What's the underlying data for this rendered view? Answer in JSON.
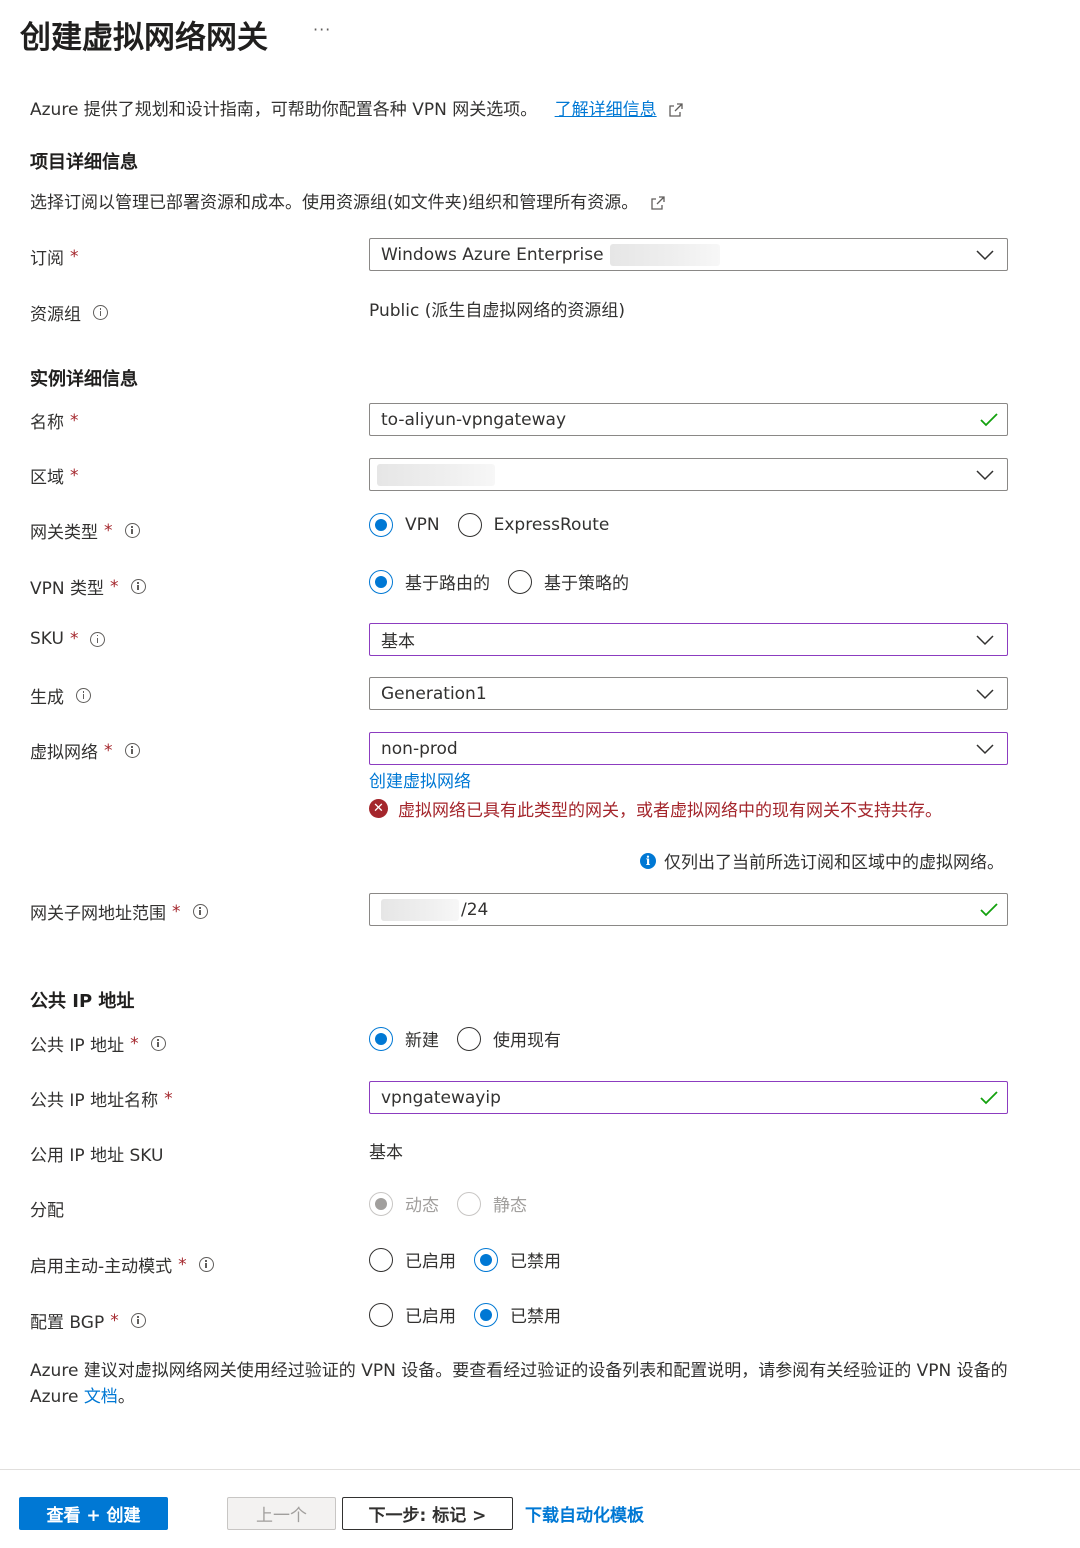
{
  "header": {
    "title": "创建虚拟网络网关",
    "more": "···"
  },
  "intro": {
    "text": "Azure 提供了规划和设计指南，可帮助你配置各种 VPN 网关选项。",
    "link": "了解详细信息"
  },
  "project": {
    "heading": "项目详细信息",
    "description": "选择订阅以管理已部署资源和成本。使用资源组(如文件夹)组织和管理所有资源。",
    "subscription": {
      "label": "订阅",
      "required": "*",
      "value": "Windows Azure Enterprise"
    },
    "resource_group": {
      "label": "资源组",
      "value": "Public (派生自虚拟网络的资源组)"
    }
  },
  "instance": {
    "heading": "实例详细信息",
    "name": {
      "label": "名称",
      "required": "*",
      "value": "to-aliyun-vpngateway"
    },
    "region": {
      "label": "区域",
      "required": "*"
    },
    "gateway_type": {
      "label": "网关类型",
      "required": "*",
      "options": [
        "VPN",
        "ExpressRoute"
      ],
      "selected": "VPN"
    },
    "vpn_type": {
      "label": "VPN 类型",
      "required": "*",
      "options": [
        "基于路由的",
        "基于策略的"
      ],
      "selected": "基于路由的"
    },
    "sku": {
      "label": "SKU",
      "required": "*",
      "value": "基本"
    },
    "generation": {
      "label": "生成",
      "value": "Generation1"
    },
    "vnet": {
      "label": "虚拟网络",
      "required": "*",
      "value": "non-prod",
      "create_link": "创建虚拟网络",
      "error": "虚拟网络已具有此类型的网关，或者虚拟网络中的现有网关不支持共存。",
      "note": "仅列出了当前所选订阅和区域中的虚拟网络。"
    },
    "subnet_range": {
      "label": "网关子网地址范围",
      "required": "*",
      "value_suffix": "/24"
    }
  },
  "public_ip": {
    "heading": "公共 IP 地址",
    "address": {
      "label": "公共 IP 地址",
      "required": "*",
      "options": [
        "新建",
        "使用现有"
      ],
      "selected": "新建"
    },
    "name": {
      "label": "公共 IP 地址名称",
      "required": "*",
      "value": "vpngatewayip"
    },
    "sku": {
      "label": "公用 IP 地址 SKU",
      "value": "基本"
    },
    "assignment": {
      "label": "分配",
      "options": [
        "动态",
        "静态"
      ],
      "selected": "动态",
      "disabled": true
    },
    "active_active": {
      "label": "启用主动-主动模式",
      "required": "*",
      "options": [
        "已启用",
        "已禁用"
      ],
      "selected": "已禁用"
    },
    "bgp": {
      "label": "配置 BGP",
      "required": "*",
      "options": [
        "已启用",
        "已禁用"
      ],
      "selected": "已禁用"
    }
  },
  "recommendation": {
    "text": "Azure 建议对虚拟网络网关使用经过验证的 VPN 设备。要查看经过验证的设备列表和配置说明，请参阅有关经验证的 VPN 设备的 Azure ",
    "link": "文档",
    "end": "。"
  },
  "footer": {
    "review_create": "查看 + 创建",
    "previous": "上一个",
    "next": "下一步: 标记 >",
    "download": "下载自动化模板"
  },
  "colors": {
    "accent": "#0078d4",
    "error": "#a4262c",
    "success": "#13a10e",
    "focus_border": "#8c3cc0"
  }
}
